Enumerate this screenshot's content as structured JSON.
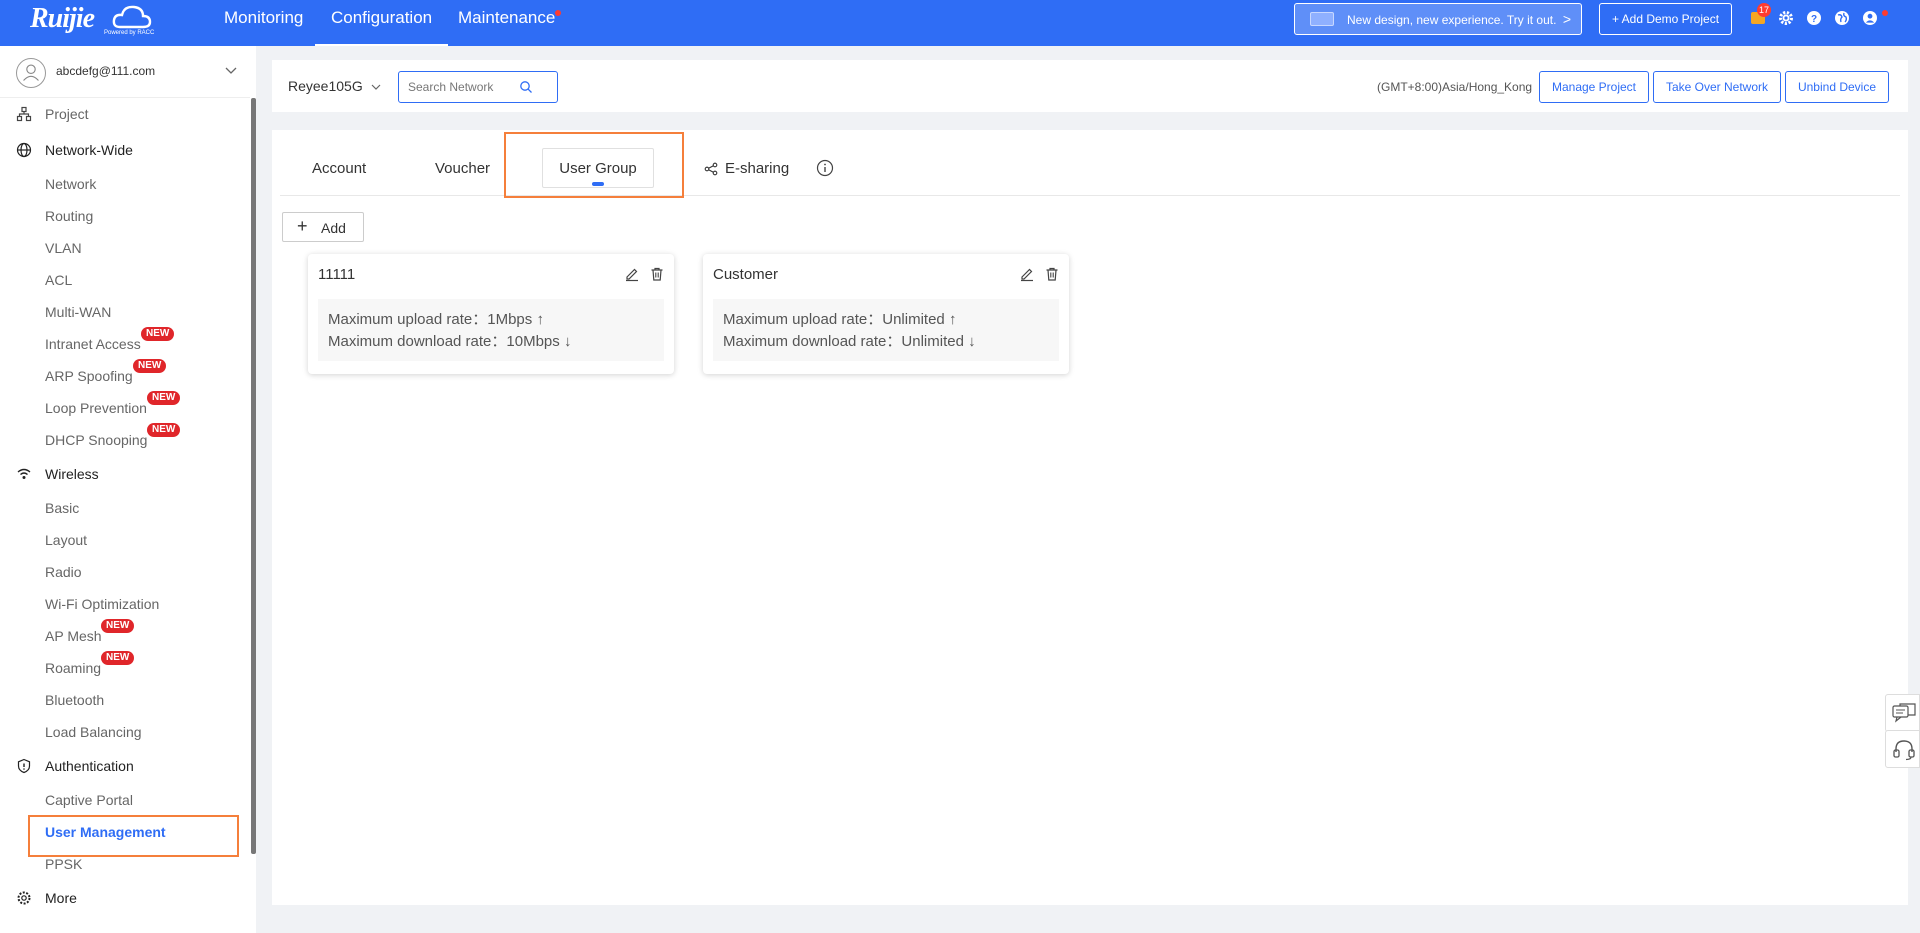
{
  "topbar": {
    "logo": "Ruijie",
    "logo_sub": "Powered by RACC",
    "nav": [
      {
        "label": "Monitoring",
        "active": false
      },
      {
        "label": "Configuration",
        "active": true
      },
      {
        "label": "Maintenance",
        "active": false,
        "dot": true
      }
    ],
    "promo_label": "New design, new experience. Try it out.",
    "demo_label": "+ Add Demo Project",
    "notification_count": "17",
    "icons": [
      "message-icon",
      "gear-icon",
      "help-icon",
      "globe-icon",
      "user-icon"
    ]
  },
  "sidebar": {
    "user_email": "abcdefg@111.com",
    "new_badge": "NEW",
    "groups": {
      "project": "Project",
      "network_wide": "Network-Wide",
      "wireless": "Wireless",
      "authentication": "Authentication",
      "more": "More"
    },
    "network_items": [
      "Network",
      "Routing",
      "VLAN",
      "ACL",
      "Multi-WAN",
      "Intranet Access",
      "ARP Spoofing",
      "Loop Prevention",
      "DHCP Snooping"
    ],
    "wireless_items": [
      "Basic",
      "Layout",
      "Radio",
      "Wi-Fi Optimization",
      "AP Mesh",
      "Roaming",
      "Bluetooth",
      "Load Balancing"
    ],
    "auth_items": [
      "Captive Portal",
      "User Management",
      "PPSK"
    ],
    "active_item": "User Management"
  },
  "header": {
    "network_name": "Reyee105G",
    "search_placeholder": "Search Network",
    "timezone": "(GMT+8:00)Asia/Hong_Kong",
    "buttons": [
      "Manage Project",
      "Take Over Network",
      "Unbind Device"
    ]
  },
  "tabs": {
    "items": [
      "Account",
      "Voucher",
      "User Group",
      "E-sharing"
    ],
    "selected": "User Group"
  },
  "add_button": "Add",
  "groups": [
    {
      "name": "11111",
      "upload_label": "Maximum upload rate：",
      "upload_value": "1Mbps",
      "download_label": "Maximum download rate：",
      "download_value": "10Mbps"
    },
    {
      "name": "Customer",
      "upload_label": "Maximum upload rate：",
      "upload_value": "Unlimited",
      "download_label": "Maximum download rate：",
      "download_value": "Unlimited"
    }
  ],
  "colors": {
    "brand": "#2f6df5",
    "highlight": "#f57f3b",
    "new_badge": "#e0262a"
  }
}
